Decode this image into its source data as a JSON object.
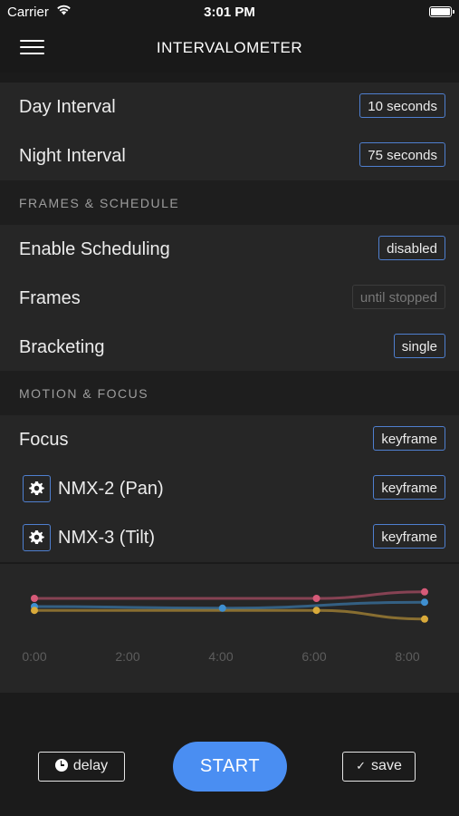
{
  "status_bar": {
    "carrier": "Carrier",
    "time": "3:01 PM"
  },
  "nav": {
    "title": "INTERVALOMETER"
  },
  "intervals": {
    "day": {
      "label": "Day Interval",
      "value": "10 seconds"
    },
    "night": {
      "label": "Night Interval",
      "value": "75 seconds"
    }
  },
  "frames_schedule": {
    "header": "FRAMES & SCHEDULE",
    "scheduling": {
      "label": "Enable Scheduling",
      "value": "disabled"
    },
    "frames": {
      "label": "Frames",
      "value": "until stopped"
    },
    "bracketing": {
      "label": "Bracketing",
      "value": "single"
    }
  },
  "motion_focus": {
    "header": "MOTION & FOCUS",
    "focus": {
      "label": "Focus",
      "value": "keyframe"
    },
    "nmx2": {
      "label": "NMX-2 (Pan)",
      "value": "keyframe"
    },
    "nmx3": {
      "label": "NMX-3 (Tilt)",
      "value": "keyframe"
    }
  },
  "chart_data": {
    "type": "line",
    "x_ticks": [
      "0:00",
      "2:00",
      "4:00",
      "6:00",
      "8:00"
    ],
    "xlim": [
      0,
      8.3
    ],
    "ylim": [
      0,
      1
    ],
    "grid": false,
    "series": [
      {
        "color": "#d65a78",
        "x": [
          0,
          6,
          8.3
        ],
        "y": [
          0.7,
          0.7,
          0.82
        ],
        "points": [
          {
            "x": 0,
            "y": 0.7
          },
          {
            "x": 6,
            "y": 0.7
          },
          {
            "x": 8.3,
            "y": 0.82
          }
        ]
      },
      {
        "color": "#3f8fd0",
        "x": [
          0,
          4,
          8.3
        ],
        "y": [
          0.55,
          0.52,
          0.63
        ],
        "points": [
          {
            "x": 0,
            "y": 0.55
          },
          {
            "x": 4,
            "y": 0.52
          },
          {
            "x": 8.3,
            "y": 0.63
          }
        ]
      },
      {
        "color": "#d9aa3a",
        "x": [
          0,
          6,
          8.3
        ],
        "y": [
          0.48,
          0.48,
          0.32
        ],
        "points": [
          {
            "x": 0,
            "y": 0.48
          },
          {
            "x": 6,
            "y": 0.48
          },
          {
            "x": 8.3,
            "y": 0.32
          }
        ]
      }
    ]
  },
  "footer": {
    "delay_label": "delay",
    "start_label": "START",
    "save_label": "save",
    "check_glyph": "✓"
  },
  "colors": {
    "accent": "#4a8ef2",
    "pill_border": "#4f7fcf",
    "background": "#1b1b1b",
    "row": "#262626"
  }
}
